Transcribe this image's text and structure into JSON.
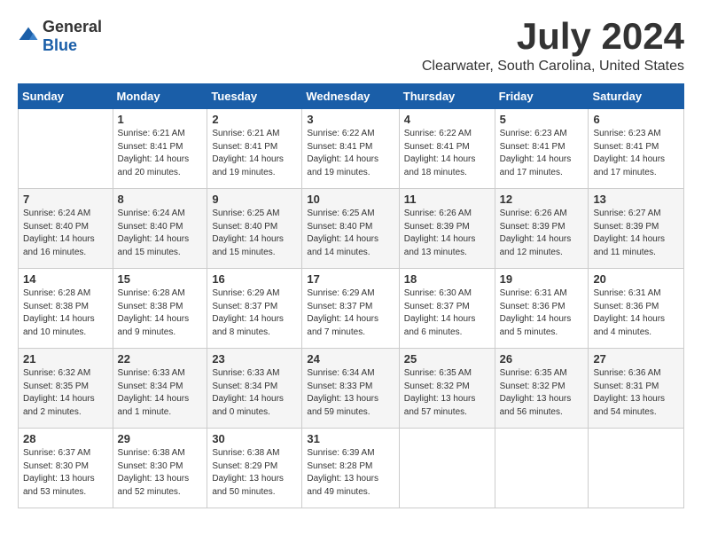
{
  "logo": {
    "text_general": "General",
    "text_blue": "Blue"
  },
  "title": "July 2024",
  "location": "Clearwater, South Carolina, United States",
  "days_of_week": [
    "Sunday",
    "Monday",
    "Tuesday",
    "Wednesday",
    "Thursday",
    "Friday",
    "Saturday"
  ],
  "weeks": [
    [
      {
        "day": "",
        "info": ""
      },
      {
        "day": "1",
        "info": "Sunrise: 6:21 AM\nSunset: 8:41 PM\nDaylight: 14 hours\nand 20 minutes."
      },
      {
        "day": "2",
        "info": "Sunrise: 6:21 AM\nSunset: 8:41 PM\nDaylight: 14 hours\nand 19 minutes."
      },
      {
        "day": "3",
        "info": "Sunrise: 6:22 AM\nSunset: 8:41 PM\nDaylight: 14 hours\nand 19 minutes."
      },
      {
        "day": "4",
        "info": "Sunrise: 6:22 AM\nSunset: 8:41 PM\nDaylight: 14 hours\nand 18 minutes."
      },
      {
        "day": "5",
        "info": "Sunrise: 6:23 AM\nSunset: 8:41 PM\nDaylight: 14 hours\nand 17 minutes."
      },
      {
        "day": "6",
        "info": "Sunrise: 6:23 AM\nSunset: 8:41 PM\nDaylight: 14 hours\nand 17 minutes."
      }
    ],
    [
      {
        "day": "7",
        "info": "Sunrise: 6:24 AM\nSunset: 8:40 PM\nDaylight: 14 hours\nand 16 minutes."
      },
      {
        "day": "8",
        "info": "Sunrise: 6:24 AM\nSunset: 8:40 PM\nDaylight: 14 hours\nand 15 minutes."
      },
      {
        "day": "9",
        "info": "Sunrise: 6:25 AM\nSunset: 8:40 PM\nDaylight: 14 hours\nand 15 minutes."
      },
      {
        "day": "10",
        "info": "Sunrise: 6:25 AM\nSunset: 8:40 PM\nDaylight: 14 hours\nand 14 minutes."
      },
      {
        "day": "11",
        "info": "Sunrise: 6:26 AM\nSunset: 8:39 PM\nDaylight: 14 hours\nand 13 minutes."
      },
      {
        "day": "12",
        "info": "Sunrise: 6:26 AM\nSunset: 8:39 PM\nDaylight: 14 hours\nand 12 minutes."
      },
      {
        "day": "13",
        "info": "Sunrise: 6:27 AM\nSunset: 8:39 PM\nDaylight: 14 hours\nand 11 minutes."
      }
    ],
    [
      {
        "day": "14",
        "info": "Sunrise: 6:28 AM\nSunset: 8:38 PM\nDaylight: 14 hours\nand 10 minutes."
      },
      {
        "day": "15",
        "info": "Sunrise: 6:28 AM\nSunset: 8:38 PM\nDaylight: 14 hours\nand 9 minutes."
      },
      {
        "day": "16",
        "info": "Sunrise: 6:29 AM\nSunset: 8:37 PM\nDaylight: 14 hours\nand 8 minutes."
      },
      {
        "day": "17",
        "info": "Sunrise: 6:29 AM\nSunset: 8:37 PM\nDaylight: 14 hours\nand 7 minutes."
      },
      {
        "day": "18",
        "info": "Sunrise: 6:30 AM\nSunset: 8:37 PM\nDaylight: 14 hours\nand 6 minutes."
      },
      {
        "day": "19",
        "info": "Sunrise: 6:31 AM\nSunset: 8:36 PM\nDaylight: 14 hours\nand 5 minutes."
      },
      {
        "day": "20",
        "info": "Sunrise: 6:31 AM\nSunset: 8:36 PM\nDaylight: 14 hours\nand 4 minutes."
      }
    ],
    [
      {
        "day": "21",
        "info": "Sunrise: 6:32 AM\nSunset: 8:35 PM\nDaylight: 14 hours\nand 2 minutes."
      },
      {
        "day": "22",
        "info": "Sunrise: 6:33 AM\nSunset: 8:34 PM\nDaylight: 14 hours\nand 1 minute."
      },
      {
        "day": "23",
        "info": "Sunrise: 6:33 AM\nSunset: 8:34 PM\nDaylight: 14 hours\nand 0 minutes."
      },
      {
        "day": "24",
        "info": "Sunrise: 6:34 AM\nSunset: 8:33 PM\nDaylight: 13 hours\nand 59 minutes."
      },
      {
        "day": "25",
        "info": "Sunrise: 6:35 AM\nSunset: 8:32 PM\nDaylight: 13 hours\nand 57 minutes."
      },
      {
        "day": "26",
        "info": "Sunrise: 6:35 AM\nSunset: 8:32 PM\nDaylight: 13 hours\nand 56 minutes."
      },
      {
        "day": "27",
        "info": "Sunrise: 6:36 AM\nSunset: 8:31 PM\nDaylight: 13 hours\nand 54 minutes."
      }
    ],
    [
      {
        "day": "28",
        "info": "Sunrise: 6:37 AM\nSunset: 8:30 PM\nDaylight: 13 hours\nand 53 minutes."
      },
      {
        "day": "29",
        "info": "Sunrise: 6:38 AM\nSunset: 8:30 PM\nDaylight: 13 hours\nand 52 minutes."
      },
      {
        "day": "30",
        "info": "Sunrise: 6:38 AM\nSunset: 8:29 PM\nDaylight: 13 hours\nand 50 minutes."
      },
      {
        "day": "31",
        "info": "Sunrise: 6:39 AM\nSunset: 8:28 PM\nDaylight: 13 hours\nand 49 minutes."
      },
      {
        "day": "",
        "info": ""
      },
      {
        "day": "",
        "info": ""
      },
      {
        "day": "",
        "info": ""
      }
    ]
  ]
}
